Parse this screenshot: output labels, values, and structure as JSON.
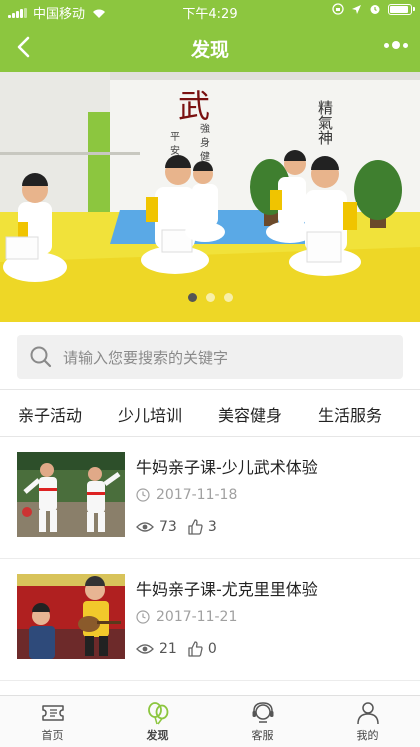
{
  "status_bar": {
    "carrier": "中国移动",
    "time": "下午4:29"
  },
  "nav": {
    "title": "发现",
    "back_icon": "chevron-left-icon",
    "more_icon": "more-dots-icon",
    "background": "#8cc63f"
  },
  "banner": {
    "calligraphy_main": "武",
    "calligraphy_right": "精氣神",
    "dots": 3,
    "active_dot": 0
  },
  "search": {
    "placeholder": "请输入您要搜索的关键字",
    "icon": "search-icon"
  },
  "tabs": [
    "亲子活动",
    "少儿培训",
    "美容健身",
    "生活服务"
  ],
  "list": [
    {
      "title": "牛妈亲子课-少儿武术体验",
      "date": "2017-11-18",
      "views": "73",
      "likes": "3"
    },
    {
      "title": "牛妈亲子课-尤克里里体验",
      "date": "2017-11-21",
      "views": "21",
      "likes": "0"
    }
  ],
  "tabbar": [
    {
      "label": "首页",
      "icon": "ticket-icon"
    },
    {
      "label": "发现",
      "icon": "balloon-icon",
      "active": true
    },
    {
      "label": "客服",
      "icon": "headset-icon"
    },
    {
      "label": "我的",
      "icon": "user-icon"
    }
  ],
  "colors": {
    "accent": "#8cc63f",
    "active_icon": "#8cc63f"
  }
}
